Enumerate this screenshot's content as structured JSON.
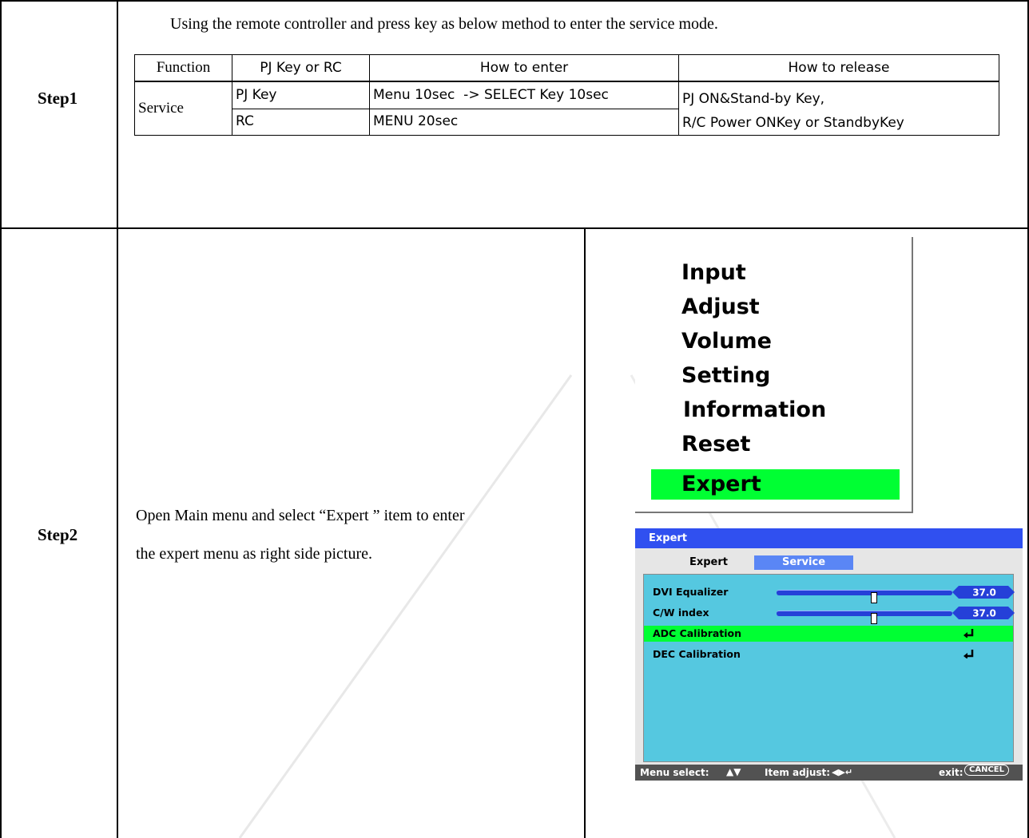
{
  "intro": "Using the remote controller and press key as below method to enter the service mode.",
  "step1": {
    "label": "Step1",
    "table": {
      "headers": [
        "Function",
        "PJ Key or RC",
        "How to enter",
        "How to release"
      ],
      "function": "Service",
      "rows": [
        {
          "key": "PJ Key",
          "enter": "Menu 10sec  -> SELECT Key 10sec"
        },
        {
          "key": "RC",
          "enter": "MENU 20sec"
        }
      ],
      "release_line1": "PJ ON&Stand-by Key,",
      "release_line2": "R/C Power ONKey or StandbyKey"
    }
  },
  "step2": {
    "label": "Step2",
    "desc_line1": "Open Main menu and select “Expert ” item to enter",
    "desc_line2": "the expert menu as right side picture."
  },
  "main_menu": {
    "items": [
      "Input",
      "Adjust",
      "Volume",
      "Setting",
      "Information",
      "Reset"
    ],
    "selected": "Expert",
    "selected_color": "#00ff33"
  },
  "expert_window": {
    "title": "Expert",
    "tabs": [
      "Expert",
      "Service"
    ],
    "active_tab": "Service",
    "rows": [
      {
        "label": "DVI Equalizer",
        "value": "37.0",
        "level": 0.55
      },
      {
        "label": "C/W index",
        "value": "37.0",
        "level": 0.55
      },
      {
        "label": "ADC Calibration"
      },
      {
        "label": "DEC Calibration"
      }
    ],
    "footer": {
      "menu_select": "Menu select:",
      "item_adjust": "Item adjust:",
      "exit": "exit:",
      "cancel": "CANCEL"
    },
    "colors": {
      "title_bar": "#3050f0",
      "panel": "#55c8e0",
      "highlight": "#00ff33",
      "footer": "#525252"
    }
  }
}
